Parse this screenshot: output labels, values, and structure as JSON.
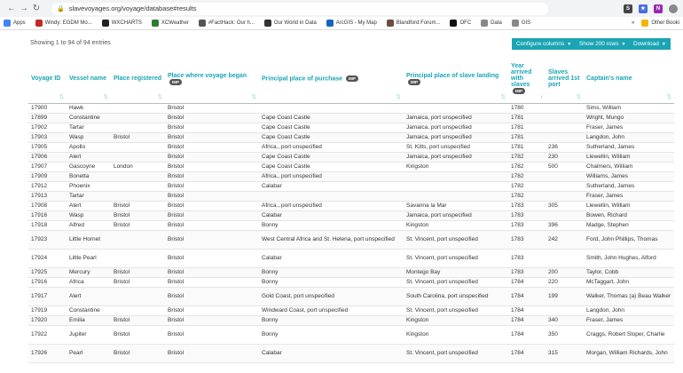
{
  "browser": {
    "url": "slavevoyages.org/voyage/database#results",
    "extensions": [
      {
        "label": "S",
        "color": "#444"
      },
      {
        "label": "★",
        "color": "#4a6ee0"
      },
      {
        "label": "N",
        "color": "#9b27b0"
      },
      {
        "label": "",
        "color": "#888"
      }
    ],
    "bookmarks": [
      {
        "label": "Apps",
        "color": "#4285f4"
      },
      {
        "label": "Windy: EGDM Mo...",
        "color": "#c62828"
      },
      {
        "label": "WXCHARTS",
        "color": "#222"
      },
      {
        "label": "XCWeather",
        "color": "#2e7d32"
      },
      {
        "label": "#FactHack: Our h...",
        "color": "#555"
      },
      {
        "label": "Our World in Data",
        "color": "#333"
      },
      {
        "label": "ArcGIS - My Map",
        "color": "#1565c0"
      },
      {
        "label": "Blandford Forum...",
        "color": "#6d4c41"
      },
      {
        "label": "OFC",
        "color": "#111"
      },
      {
        "label": "Data",
        "color": "#888"
      },
      {
        "label": "GIS",
        "color": "#888"
      }
    ],
    "bookmarks_more": "»",
    "other_bookmarks": "Other Booki"
  },
  "toolbar": {
    "showing": "Showing 1 to 94 of 94 entries",
    "configure_columns": "Configure columns",
    "show_rows": "Show 200 rows",
    "download": "Download"
  },
  "table": {
    "imp_badge": "IMP",
    "sort_glyph": "⇅",
    "sort_up_glyph": "↑",
    "columns": [
      {
        "label": "Voyage ID"
      },
      {
        "label": "Vessel name"
      },
      {
        "label": "Place registered"
      },
      {
        "label": "Place where voyage began",
        "imp": true
      },
      {
        "label": "Principal place of purchase",
        "imp": true
      },
      {
        "label": "Principal place of slave landing",
        "imp": true
      },
      {
        "label": "Year arrived with slaves",
        "imp": true
      },
      {
        "label": "Slaves arrived 1st port"
      },
      {
        "label": "Captain's name"
      }
    ],
    "rows": [
      [
        "17900",
        "Hawk",
        "",
        "Bristol",
        "",
        "",
        "1780",
        "",
        "Sims, William"
      ],
      [
        "17899",
        "Constantine",
        "",
        "Bristol",
        "Cape Coast Castle",
        "Jamaica, port unspecified",
        "1781",
        "",
        "Wright, Mungo"
      ],
      [
        "17902",
        "Tartar",
        "",
        "Bristol",
        "Cape Coast Castle",
        "Jamaica, port unspecified",
        "1781",
        "",
        "Fraser, James"
      ],
      [
        "17903",
        "Wasp",
        "Bristol",
        "Bristol",
        "Cape Coast Castle",
        "Jamaica, port unspecified",
        "1781",
        "",
        "Langdon, John"
      ],
      [
        "17905",
        "Apollo",
        "",
        "Bristol",
        "Africa., port unspecified",
        "St. Kitts, port unspecified",
        "1781",
        "236",
        "Sutherland, James"
      ],
      [
        "17906",
        "Alert",
        "",
        "Bristol",
        "Cape Coast Castle",
        "Jamaica, port unspecified",
        "1782",
        "230",
        "Llewellin, William"
      ],
      [
        "17907",
        "Gascoyne",
        "London",
        "Bristol",
        "Cape Coast Castle",
        "Kingston",
        "1782",
        "500",
        "Chalmers, William"
      ],
      [
        "17909",
        "Bonetta",
        "",
        "Bristol",
        "Africa., port unspecified",
        "",
        "1782",
        "",
        "Williams, James"
      ],
      [
        "17912",
        "Phoenix",
        "",
        "Bristol",
        "Calabar",
        "",
        "1782",
        "",
        "Sutherland, James"
      ],
      [
        "17913",
        "Tartar",
        "",
        "Bristol",
        "",
        "",
        "1782",
        "",
        "Fraser, James"
      ],
      [
        "17908",
        "Alert",
        "Bristol",
        "Bristol",
        "Africa., port unspecified",
        "Savanna la Mar",
        "1783",
        "305",
        "Llewellin, William"
      ],
      [
        "17916",
        "Wasp",
        "Bristol",
        "Bristol",
        "Calabar",
        "Jamaica, port unspecified",
        "1783",
        "",
        "Bowen, Richard"
      ],
      [
        "17918",
        "Alfred",
        "Bristol",
        "Bristol",
        "Bonny",
        "Kingston",
        "1783",
        "396",
        "Madge, Stephen"
      ],
      [
        "17923",
        "Little Hornet",
        "",
        "Bristol",
        "West Central Africa and St. Helena, port unspecified",
        "St. Vincent, port unspecified",
        "1783",
        "242",
        "Ford, John Phillips, Thomas"
      ],
      [
        "17924",
        "Little Pearl",
        "",
        "Bristol",
        "Calabar",
        "St. Vincent, port unspecified",
        "1783",
        "",
        "Smith, John Hughes, Alford"
      ],
      [
        "17925",
        "Mercury",
        "Bristol",
        "Bristol",
        "Bonny",
        "Montego Bay",
        "1783",
        "200",
        "Taylor, Cobb"
      ],
      [
        "17916",
        "Africa",
        "Bristol",
        "Bristol",
        "Bonny",
        "St. Vincent, port unspecified",
        "1784",
        "220",
        "McTaggart, John"
      ],
      [
        "17917",
        "Alert",
        "",
        "Bristol",
        "Gold Coast, port unspecified",
        "South Carolina, port unspecified",
        "1784",
        "199",
        "Walker, Thomas (a) Beau Walker"
      ],
      [
        "17919",
        "Constantine",
        "",
        "Bristol",
        "Windward Coast, port unspecified",
        "St. Vincent, port unspecified",
        "1784",
        "",
        "Langdon, John"
      ],
      [
        "17920",
        "Emilia",
        "Bristol",
        "Bristol",
        "Bonny",
        "Kingston",
        "1784",
        "340",
        "Fraser, James"
      ],
      [
        "17922",
        "Jupiter",
        "Bristol",
        "Bristol",
        "Bonny",
        "Kingston",
        "1784",
        "350",
        "Craggs, Robert Sloper, Charlie"
      ],
      [
        "17926",
        "Pearl",
        "Bristol",
        "Bristol",
        "Calabar",
        "St. Vincent, port unspecified",
        "1784",
        "315",
        "Morgan, William Richards, John"
      ]
    ]
  }
}
